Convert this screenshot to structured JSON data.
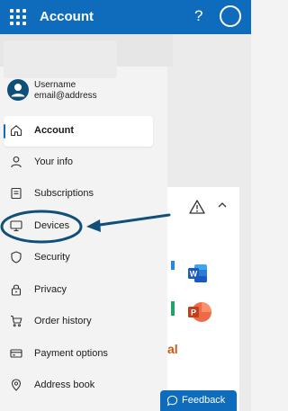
{
  "header": {
    "title": "Account",
    "help_label": "?"
  },
  "user": {
    "username": "Username",
    "email": "email@address"
  },
  "nav": [
    {
      "label": "Account",
      "icon": "home-icon",
      "active": true
    },
    {
      "label": "Your info",
      "icon": "person-icon"
    },
    {
      "label": "Subscriptions",
      "icon": "receipt-icon"
    },
    {
      "label": "Devices",
      "icon": "monitor-icon"
    },
    {
      "label": "Security",
      "icon": "shield-icon"
    },
    {
      "label": "Privacy",
      "icon": "lock-icon"
    },
    {
      "label": "Order history",
      "icon": "cart-icon"
    },
    {
      "label": "Payment options",
      "icon": "card-icon"
    },
    {
      "label": "Address book",
      "icon": "location-pin-icon"
    }
  ],
  "content": {
    "fragment_text": "al"
  },
  "feedback": {
    "label": "Feedback"
  },
  "colors": {
    "brand": "#0f6cbd",
    "annotation": "#0f4f7a"
  }
}
